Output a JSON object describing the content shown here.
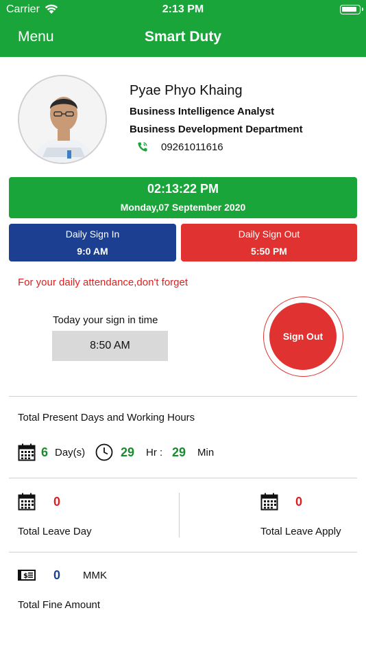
{
  "status_bar": {
    "carrier": "Carrier",
    "time": "2:13 PM"
  },
  "nav": {
    "menu_label": "Menu",
    "title": "Smart Duty"
  },
  "profile": {
    "name": "Pyae Phyo Khaing",
    "job_title": "Business Intelligence Analyst",
    "department": "Business Development Department",
    "phone": "09261011616"
  },
  "clock": {
    "time": "02:13:22 PM",
    "date": "Monday,07 September 2020"
  },
  "daily_sign_in": {
    "label": "Daily Sign In",
    "time": "9:0 AM"
  },
  "daily_sign_out": {
    "label": "Daily Sign Out",
    "time": "5:50 PM"
  },
  "reminder": "For your daily attendance,don't forget",
  "today_sign_in": {
    "label": "Today your sign in time",
    "time": "8:50 AM"
  },
  "sign_out_button": "Sign Out",
  "present": {
    "title": "Total Present Days and Working Hours",
    "days": "6",
    "days_unit": "Day(s)",
    "hours": "29",
    "hours_unit": "Hr :",
    "minutes": "29",
    "minutes_unit": "Min"
  },
  "leave": {
    "day_count": "0",
    "day_label": "Total Leave Day",
    "apply_count": "0",
    "apply_label": "Total Leave Apply"
  },
  "fine": {
    "amount": "0",
    "currency": "MMK",
    "label": "Total Fine Amount"
  },
  "icons": {
    "wifi": "wifi-icon",
    "battery": "battery-icon",
    "phone": "phone-icon",
    "calendar": "calendar-icon",
    "clock": "clock-icon",
    "money": "money-icon"
  },
  "colors": {
    "primary_green": "#1aa53a",
    "sign_in_blue": "#1c3f91",
    "sign_out_red": "#e03230",
    "alert_red": "#e01e1e",
    "number_green": "#1a8a2e"
  }
}
